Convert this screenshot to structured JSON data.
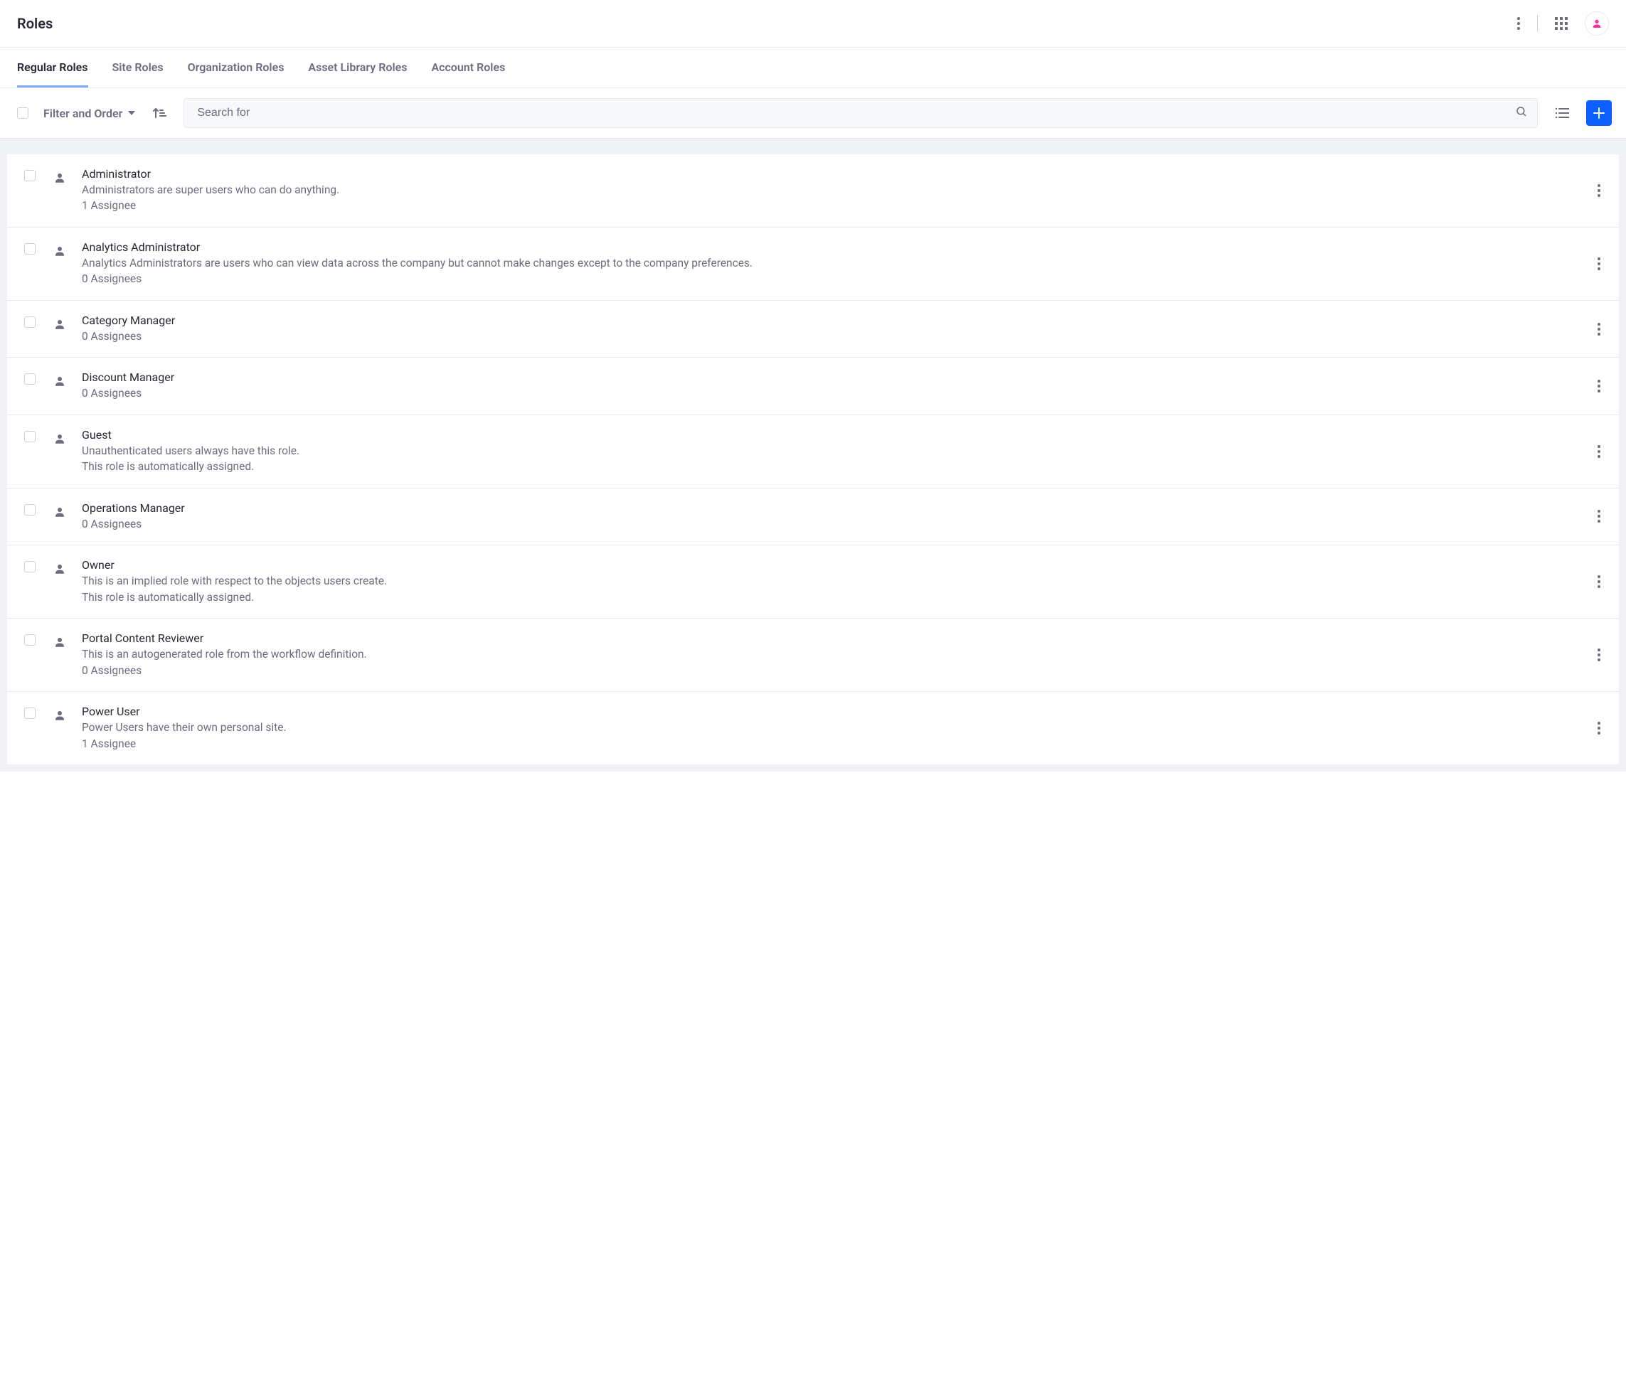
{
  "header": {
    "title": "Roles"
  },
  "tabs": {
    "items": [
      {
        "label": "Regular Roles",
        "active": true
      },
      {
        "label": "Site Roles",
        "active": false
      },
      {
        "label": "Organization Roles",
        "active": false
      },
      {
        "label": "Asset Library Roles",
        "active": false
      },
      {
        "label": "Account Roles",
        "active": false
      }
    ]
  },
  "toolbar": {
    "filter_label": "Filter and Order",
    "search_placeholder": "Search for"
  },
  "roles": [
    {
      "name": "Administrator",
      "description": "Administrators are super users who can do anything.",
      "assignees": "1 Assignee",
      "auto": ""
    },
    {
      "name": "Analytics Administrator",
      "description": "Analytics Administrators are users who can view data across the company but cannot make changes except to the company preferences.",
      "assignees": "0 Assignees",
      "auto": ""
    },
    {
      "name": "Category Manager",
      "description": "",
      "assignees": "0 Assignees",
      "auto": ""
    },
    {
      "name": "Discount Manager",
      "description": "",
      "assignees": "0 Assignees",
      "auto": ""
    },
    {
      "name": "Guest",
      "description": "Unauthenticated users always have this role.",
      "assignees": "",
      "auto": "This role is automatically assigned."
    },
    {
      "name": "Operations Manager",
      "description": "",
      "assignees": "0 Assignees",
      "auto": ""
    },
    {
      "name": "Owner",
      "description": "This is an implied role with respect to the objects users create.",
      "assignees": "",
      "auto": "This role is automatically assigned."
    },
    {
      "name": "Portal Content Reviewer",
      "description": "This is an autogenerated role from the workflow definition.",
      "assignees": "0 Assignees",
      "auto": ""
    },
    {
      "name": "Power User",
      "description": "Power Users have their own personal site.",
      "assignees": "1 Assignee",
      "auto": ""
    }
  ]
}
